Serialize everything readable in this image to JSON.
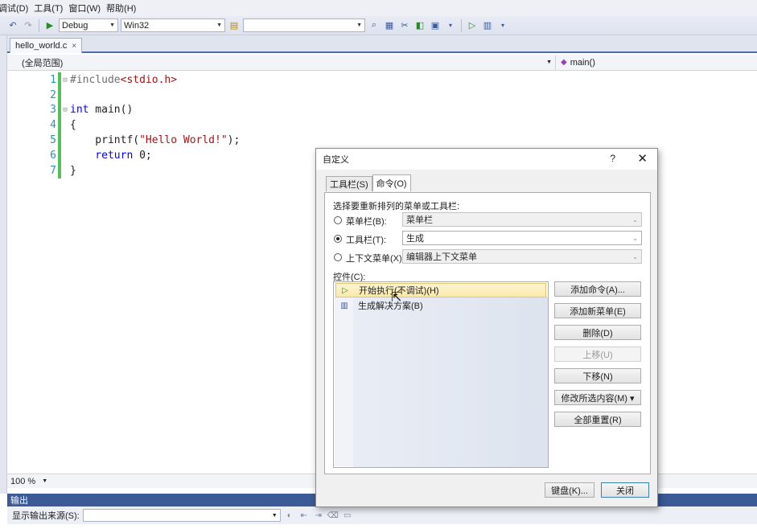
{
  "menu": [
    "调试(D)",
    "工具(T)",
    "窗口(W)",
    "帮助(H)"
  ],
  "toolbar": {
    "config_value": "Debug",
    "platform_value": "Win32",
    "find_value": ""
  },
  "document": {
    "tab_name": "hello_world.c",
    "tab_close": "×",
    "scope": "(全局范围)",
    "member": "main()"
  },
  "code_lines": [
    {
      "num": "1",
      "fold": "⊟",
      "text": "#include<stdio.h>"
    },
    {
      "num": "2",
      "fold": "",
      "text": ""
    },
    {
      "num": "3",
      "fold": "⊟",
      "text": "int main()"
    },
    {
      "num": "4",
      "fold": "",
      "text": "{"
    },
    {
      "num": "5",
      "fold": "",
      "text": "    printf(\"Hello World!\");"
    },
    {
      "num": "6",
      "fold": "",
      "text": "    return 0;"
    },
    {
      "num": "7",
      "fold": "",
      "text": "}"
    }
  ],
  "code_parts": {
    "l1_pp": "#include",
    "l1_hdr": "<stdio.h>",
    "l3_kw": "int",
    "l3_rest": " main()",
    "l4": "{",
    "l5_pre": "    printf(",
    "l5_str": "\"Hello World!\"",
    "l5_post": ");",
    "l6_kw": "    return",
    "l6_rest": " 0;",
    "l7": "}"
  },
  "zoom": "100 %",
  "output": {
    "title": "输出",
    "source_label": "显示输出来源(S):",
    "source_value": ""
  },
  "dialog": {
    "title": "自定义",
    "help": "?",
    "close": "✕",
    "tabs": [
      "工具栏(S)",
      "命令(O)"
    ],
    "active_tab": "命令(O)",
    "choose_label": "选择要重新排列的菜单或工具栏:",
    "menubar_label": "菜单栏(B):",
    "menubar_value": "菜单栏",
    "toolbar_label": "工具栏(T):",
    "toolbar_value": "生成",
    "context_label": "上下文菜单(X):",
    "context_value": "编辑器上下文菜单",
    "controls_label": "控件(C):",
    "items": [
      "开始执行(不调试)(H)",
      "生成解决方案(B)"
    ],
    "buttons": {
      "add_command": "添加命令(A)...",
      "add_menu": "添加新菜单(E)",
      "delete": "删除(D)",
      "move_up": "上移(U)",
      "move_down": "下移(N)",
      "modify": "修改所选内容(M) ▾",
      "reset_all": "全部重置(R)",
      "keyboard": "键盘(K)...",
      "close": "关闭"
    }
  }
}
